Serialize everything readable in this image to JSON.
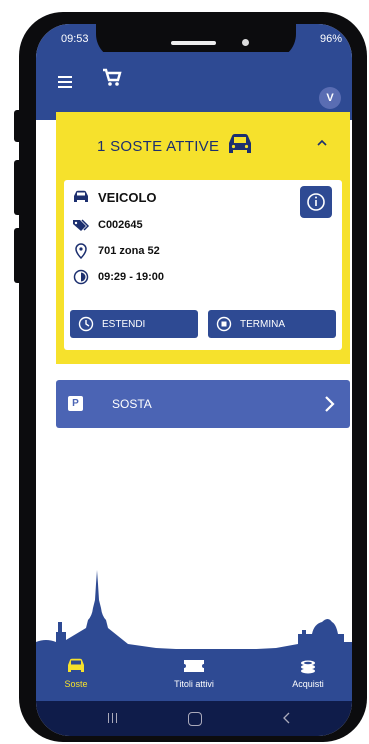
{
  "status_bar": {
    "time": "09:53",
    "battery": "96%"
  },
  "app_bar": {
    "avatar_initial": "V"
  },
  "active_parking": {
    "title": "1 SOSTE ATTIVE",
    "vehicle_label": "VEICOLO",
    "plate": "C002645",
    "zone": "701 zona 52",
    "time_range": "09:29 - 19:00",
    "extend_label": "ESTENDI",
    "terminate_label": "TERMINA"
  },
  "sosta_item": {
    "badge": "P",
    "label": "SOSTA"
  },
  "bottom_nav": [
    {
      "label": "Soste",
      "icon": "car-icon",
      "active": true
    },
    {
      "label": "Titoli attivi",
      "icon": "ticket-icon",
      "active": false
    },
    {
      "label": "Acquisti",
      "icon": "coins-icon",
      "active": false
    }
  ],
  "colors": {
    "primary": "#2e4a93",
    "accent": "#f6e12c",
    "secondary": "#4b64b4"
  }
}
